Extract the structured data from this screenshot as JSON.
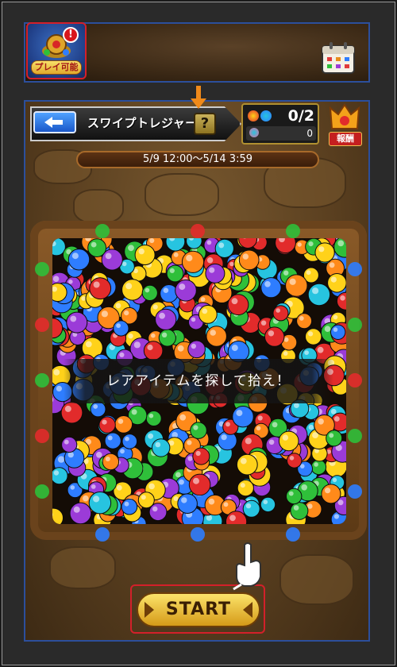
{
  "top_bar": {
    "play_label": "プレイ可能",
    "alert_mark": "!",
    "icons": [
      "treasure-event-icon",
      "calendar-icon"
    ]
  },
  "header": {
    "title": "スワイプトレジャー",
    "help_label": "?",
    "back_icon": "back-arrow-icon"
  },
  "counter": {
    "found": "0/2",
    "items": "0"
  },
  "reward": {
    "label": "報酬"
  },
  "event": {
    "period": "5/9 12:00〜5/14 3:59"
  },
  "pit": {
    "message": "レアアイテムを探して拾え！",
    "orb_colors": [
      "#2e7dff",
      "#ffd21a",
      "#e22b2b",
      "#2fbf3a",
      "#9b3bd8",
      "#27c4e0",
      "#ff8a1a"
    ]
  },
  "start": {
    "label": "START"
  },
  "colors": {
    "highlight_red": "#d3202a",
    "panel_blue": "#2c4f9c",
    "tutorial_arrow": "#f08a1a"
  }
}
